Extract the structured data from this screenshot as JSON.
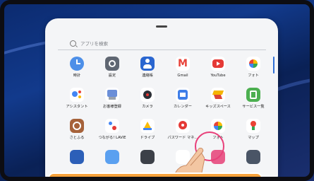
{
  "search": {
    "placeholder": "アプリを検索"
  },
  "apps": [
    {
      "label": "時計",
      "icon": "clock-icon",
      "color": "#4d8fe8"
    },
    {
      "label": "設定",
      "icon": "settings-gear-icon",
      "color": "#5f6672"
    },
    {
      "label": "連絡帳",
      "icon": "contacts-icon",
      "color": "#2a66d0"
    },
    {
      "label": "Gmail",
      "icon": "gmail-icon",
      "color": "#ffffff"
    },
    {
      "label": "YouTube",
      "icon": "youtube-icon",
      "color": "#e53935"
    },
    {
      "label": "フォト",
      "icon": "google-photos-icon",
      "color": "#ffffff"
    },
    {
      "label": "アシスタント",
      "icon": "assistant-icon",
      "color": "#ffffff"
    },
    {
      "label": "お客様登録",
      "icon": "customer-registration-icon",
      "color": "#ffffff"
    },
    {
      "label": "カメラ",
      "icon": "camera-icon",
      "color": "#ffffff"
    },
    {
      "label": "カレンダー",
      "icon": "calendar-icon",
      "color": "#3f7ee8"
    },
    {
      "label": "キッズスペース",
      "icon": "kids-space-icon",
      "color": "#ffffff"
    },
    {
      "label": "サービス一覧",
      "icon": "service-list-icon",
      "color": "#4caf50"
    },
    {
      "label": "さとふる",
      "icon": "satofuru-icon",
      "color": "#a6623a"
    },
    {
      "label": "つながる! LAVIE",
      "icon": "lavie-icon",
      "color": "#ffffff"
    },
    {
      "label": "ドライブ",
      "icon": "drive-icon",
      "color": "#ffffff"
    },
    {
      "label": "パスワード マネ…",
      "icon": "password-manager-icon",
      "color": "#ffffff"
    },
    {
      "label": "フォト",
      "icon": "google-photos-icon",
      "color": "#ffffff"
    },
    {
      "label": "マップ",
      "icon": "maps-icon",
      "color": "#ffffff"
    },
    {
      "label": "",
      "icon": "app-icon",
      "color": "#2c5fb8"
    },
    {
      "label": "",
      "icon": "app-icon",
      "color": "#5aa0f0"
    },
    {
      "label": "",
      "icon": "app-icon",
      "color": "#3c4048"
    },
    {
      "label": "",
      "icon": "app-icon",
      "color": "#ffffff"
    },
    {
      "label": "",
      "icon": "app-icon",
      "color": "#e85b8a"
    },
    {
      "label": "",
      "icon": "app-icon",
      "color": "#4a5566"
    }
  ]
}
